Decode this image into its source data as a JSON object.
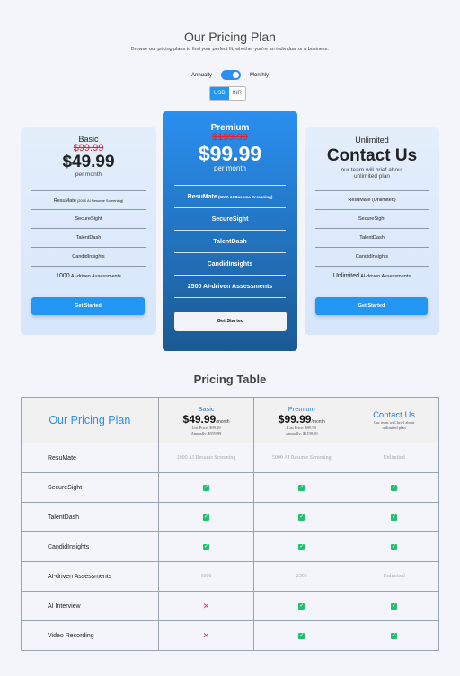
{
  "header": {
    "title": "Our Pricing Plan",
    "subtitle": "Browse our pricing plans to find your perfect fit, whether you're an individual or a business."
  },
  "billing": {
    "annually": "Annually",
    "monthly": "Monthly",
    "selected": "monthly"
  },
  "currency": {
    "usd": "USD",
    "inr": "INR",
    "selected": "USD"
  },
  "plans": {
    "basic": {
      "name": "Basic",
      "old_price": "$99.99",
      "price": "$49.99",
      "per": "per month",
      "features": [
        {
          "main": "ResuMate",
          "extra": " (2000 AI Resume Screening)"
        },
        {
          "main": "SecureSight",
          "extra": ""
        },
        {
          "main": "TalentDash",
          "extra": ""
        },
        {
          "main": "CandidInsights",
          "extra": ""
        },
        {
          "main": "1000",
          "extra": " AI-driven Assessments"
        }
      ],
      "cta": "Get Started"
    },
    "premium": {
      "name": "Premium",
      "old_price": "$199.99",
      "price": "$99.99",
      "per": "per month",
      "features": [
        {
          "main": "ResuMate",
          "extra": " (5000 AI Resume Screening)"
        },
        {
          "main": "SecureSight",
          "extra": ""
        },
        {
          "main": "TalentDash",
          "extra": ""
        },
        {
          "main": "CandidInsights",
          "extra": ""
        },
        {
          "main": "2500 AI-driven Assessments",
          "extra": ""
        }
      ],
      "cta": "Get Started"
    },
    "unlimited": {
      "name": "Unlimited",
      "headline": "Contact Us",
      "note": "our team will brief about unlimited plan",
      "features": [
        {
          "main": "ResuMate",
          "extra": " (Unlimited)"
        },
        {
          "main": "SecureSight",
          "extra": ""
        },
        {
          "main": "TalentDash",
          "extra": ""
        },
        {
          "main": "CandidInsights",
          "extra": ""
        },
        {
          "main": "Unlimited",
          "extra": " AI-driven Assessments"
        }
      ],
      "cta": "Get Started"
    }
  },
  "pricing_table": {
    "title": "Pricing Table",
    "header": {
      "plan_label": "Our Pricing Plan",
      "basic": {
        "name": "Basic",
        "price": "$49.99",
        "per": "/month",
        "list": "List Price: $99.99",
        "annual": "Annually: $599.99"
      },
      "premium": {
        "name": "Premium",
        "price": "$99.99",
        "per": "/month",
        "list": "List Price: $99.99",
        "annual": "Annually: $1199.99"
      },
      "unlimited": {
        "name": "Contact Us",
        "note": "Our team will brief about unlimited plan"
      }
    },
    "rows": [
      {
        "feature": "ResuMate",
        "basic": "2000 AI Resume Screening",
        "premium": "5000 AI Resume Screening",
        "unlimited": "Unlimited"
      },
      {
        "feature": "SecureSight",
        "basic": "check",
        "premium": "check",
        "unlimited": "check"
      },
      {
        "feature": "TalentDash",
        "basic": "check",
        "premium": "check",
        "unlimited": "check"
      },
      {
        "feature": "CandidInsights",
        "basic": "check",
        "premium": "check",
        "unlimited": "check"
      },
      {
        "feature": "AI-driven Assessments",
        "basic": "1000",
        "premium": "2500",
        "unlimited": "Unlimited"
      },
      {
        "feature": "AI Interview",
        "basic": "cross",
        "premium": "check",
        "unlimited": "check"
      },
      {
        "feature": "Video Recording",
        "basic": "cross",
        "premium": "check",
        "unlimited": "check"
      }
    ]
  },
  "colors": {
    "accent": "#2196f3",
    "premium_top": "#2a8ff0",
    "premium_bottom": "#1b5a93",
    "check": "#22c06a",
    "cross": "#e8315a",
    "strike": "#e3202c"
  }
}
